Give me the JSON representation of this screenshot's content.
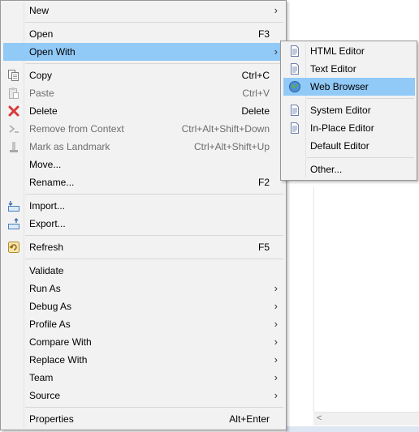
{
  "context_menu": {
    "items": [
      {
        "label": "New",
        "shortcut": "",
        "submenu": true,
        "icon": "",
        "disabled": false
      },
      {
        "label": "Open",
        "shortcut": "F3",
        "submenu": false,
        "icon": "",
        "disabled": false
      },
      {
        "label": "Open With",
        "shortcut": "",
        "submenu": true,
        "icon": "",
        "disabled": false,
        "highlighted": true
      },
      {
        "label": "Copy",
        "shortcut": "Ctrl+C",
        "submenu": false,
        "icon": "copy-icon",
        "disabled": false
      },
      {
        "label": "Paste",
        "shortcut": "Ctrl+V",
        "submenu": false,
        "icon": "paste-icon",
        "disabled": true
      },
      {
        "label": "Delete",
        "shortcut": "Delete",
        "submenu": false,
        "icon": "delete-icon",
        "disabled": false
      },
      {
        "label": "Remove from Context",
        "shortcut": "Ctrl+Alt+Shift+Down",
        "submenu": false,
        "icon": "remove-context-icon",
        "disabled": true
      },
      {
        "label": "Mark as Landmark",
        "shortcut": "Ctrl+Alt+Shift+Up",
        "submenu": false,
        "icon": "landmark-icon",
        "disabled": true
      },
      {
        "label": "Move...",
        "shortcut": "",
        "submenu": false,
        "icon": "",
        "disabled": false
      },
      {
        "label": "Rename...",
        "shortcut": "F2",
        "submenu": false,
        "icon": "",
        "disabled": false
      },
      {
        "label": "Import...",
        "shortcut": "",
        "submenu": false,
        "icon": "import-icon",
        "disabled": false
      },
      {
        "label": "Export...",
        "shortcut": "",
        "submenu": false,
        "icon": "export-icon",
        "disabled": false
      },
      {
        "label": "Refresh",
        "shortcut": "F5",
        "submenu": false,
        "icon": "refresh-icon",
        "disabled": false
      },
      {
        "label": "Validate",
        "shortcut": "",
        "submenu": false,
        "icon": "",
        "disabled": false
      },
      {
        "label": "Run As",
        "shortcut": "",
        "submenu": true,
        "icon": "",
        "disabled": false
      },
      {
        "label": "Debug As",
        "shortcut": "",
        "submenu": true,
        "icon": "",
        "disabled": false
      },
      {
        "label": "Profile As",
        "shortcut": "",
        "submenu": true,
        "icon": "",
        "disabled": false
      },
      {
        "label": "Compare With",
        "shortcut": "",
        "submenu": true,
        "icon": "",
        "disabled": false
      },
      {
        "label": "Replace With",
        "shortcut": "",
        "submenu": true,
        "icon": "",
        "disabled": false
      },
      {
        "label": "Team",
        "shortcut": "",
        "submenu": true,
        "icon": "",
        "disabled": false
      },
      {
        "label": "Source",
        "shortcut": "",
        "submenu": true,
        "icon": "",
        "disabled": false
      },
      {
        "label": "Properties",
        "shortcut": "Alt+Enter",
        "submenu": false,
        "icon": "",
        "disabled": false
      }
    ]
  },
  "open_with_submenu": {
    "items": [
      {
        "label": "HTML Editor",
        "icon": "html-editor-icon"
      },
      {
        "label": "Text Editor",
        "icon": "text-editor-icon"
      },
      {
        "label": "Web Browser",
        "icon": "globe-icon",
        "highlighted": true
      },
      {
        "label": "System Editor",
        "icon": "system-editor-icon"
      },
      {
        "label": "In-Place Editor",
        "icon": "in-place-editor-icon"
      },
      {
        "label": "Default Editor",
        "icon": ""
      },
      {
        "label": "Other...",
        "icon": ""
      }
    ]
  },
  "colors": {
    "menu_background": "#f2f2f2",
    "highlight": "#91c9f7",
    "disabled_text": "#6d6d6d",
    "delete_red": "#d83b3b"
  }
}
